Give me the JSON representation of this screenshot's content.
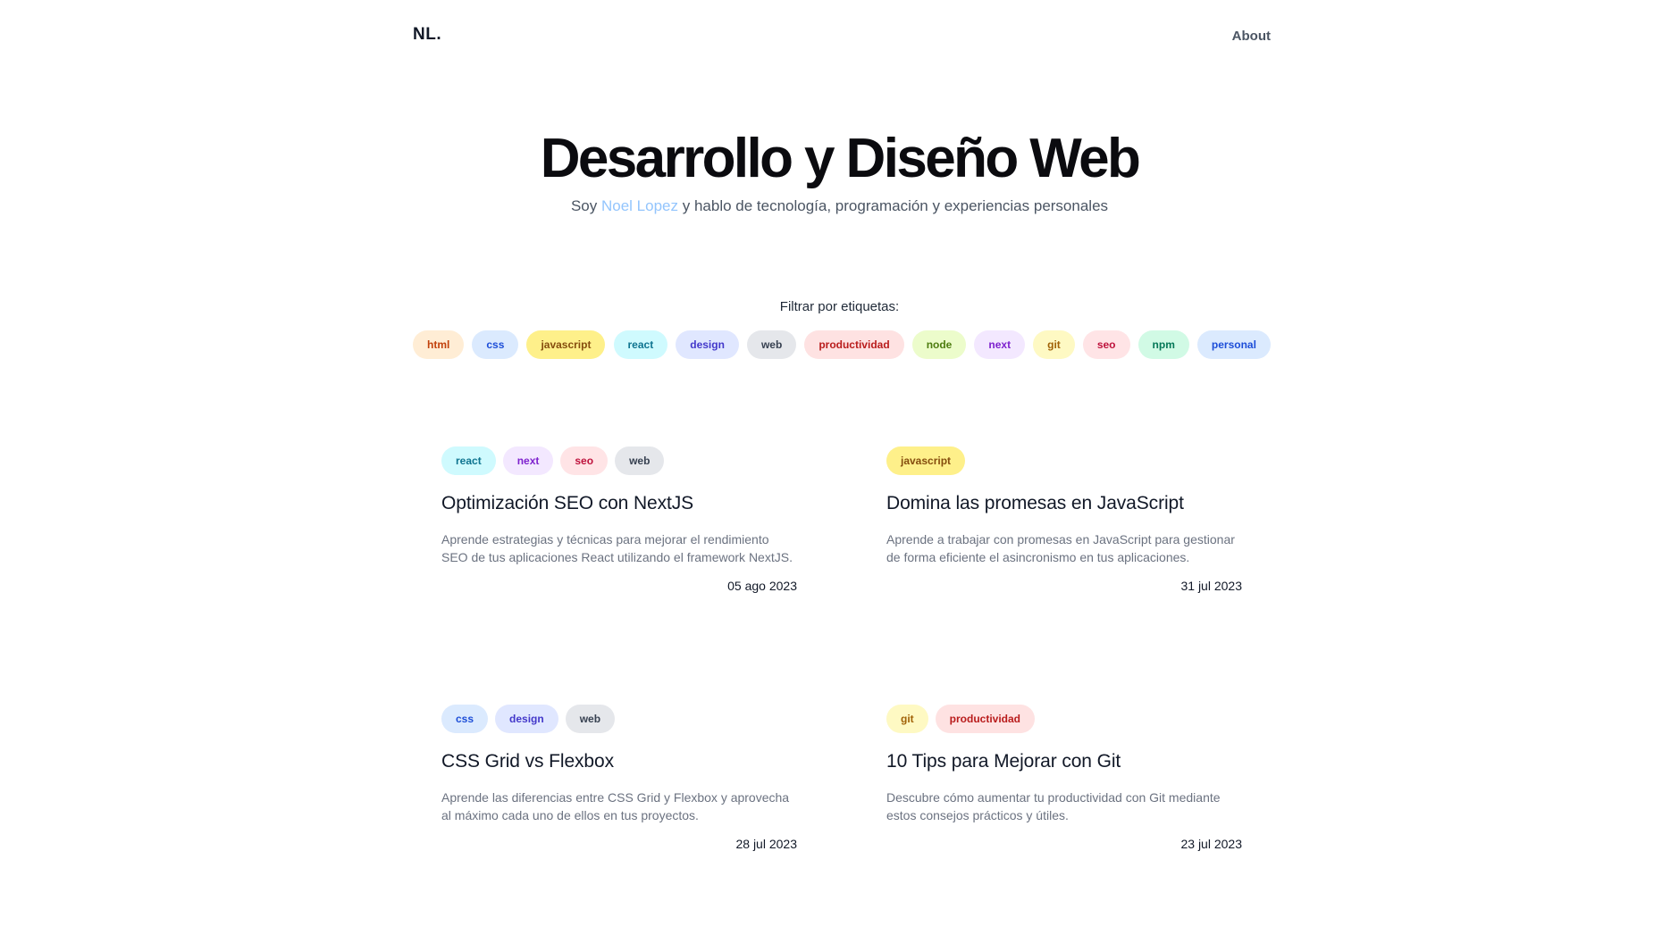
{
  "header": {
    "logo": "NL.",
    "about": "About"
  },
  "hero": {
    "title": "Desarrollo y Diseño Web",
    "subtitle_prefix": "Soy ",
    "author": "Noel Lopez",
    "subtitle_suffix": " y hablo de tecnología, programación y experiencias personales"
  },
  "filter": {
    "label": "Filtrar por etiquetas:",
    "tags": [
      "html",
      "css",
      "javascript",
      "react",
      "design",
      "web",
      "productividad",
      "node",
      "next",
      "git",
      "seo",
      "npm",
      "personal"
    ]
  },
  "posts": [
    {
      "tags": [
        "react",
        "next",
        "seo",
        "web"
      ],
      "title": "Optimización SEO con NextJS",
      "description": "Aprende estrategias y técnicas para mejorar el rendimiento SEO de tus aplicaciones React utilizando el framework NextJS.",
      "date": "05 ago 2023"
    },
    {
      "tags": [
        "javascript"
      ],
      "title": "Domina las promesas en JavaScript",
      "description": "Aprende a trabajar con promesas en JavaScript para gestionar de forma eficiente el asincronismo en tus aplicaciones.",
      "date": "31 jul 2023"
    },
    {
      "tags": [
        "css",
        "design",
        "web"
      ],
      "title": "CSS Grid vs Flexbox",
      "description": "Aprende las diferencias entre CSS Grid y Flexbox y aprovecha al máximo cada uno de ellos en tus proyectos.",
      "date": "28 jul 2023"
    },
    {
      "tags": [
        "git",
        "productividad"
      ],
      "title": "10 Tips para Mejorar con Git",
      "description": "Descubre cómo aumentar tu productividad con Git mediante estos consejos prácticos y útiles.",
      "date": "23 jul 2023"
    }
  ]
}
